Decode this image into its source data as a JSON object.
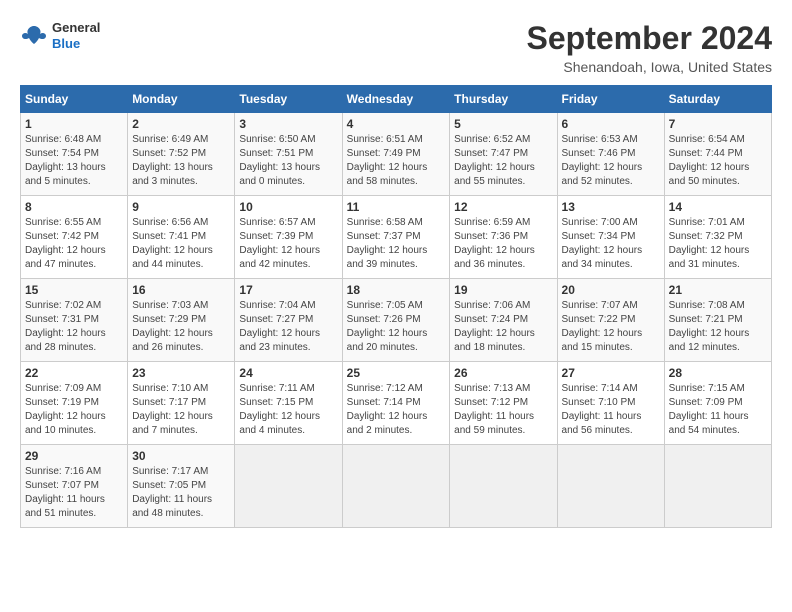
{
  "header": {
    "logo": {
      "general": "General",
      "blue": "Blue"
    },
    "title": "September 2024",
    "location": "Shenandoah, Iowa, United States"
  },
  "calendar": {
    "weekdays": [
      "Sunday",
      "Monday",
      "Tuesday",
      "Wednesday",
      "Thursday",
      "Friday",
      "Saturday"
    ],
    "weeks": [
      [
        {
          "day": "1",
          "sunrise": "6:48 AM",
          "sunset": "7:54 PM",
          "daylight": "13 hours and 5 minutes."
        },
        {
          "day": "2",
          "sunrise": "6:49 AM",
          "sunset": "7:52 PM",
          "daylight": "13 hours and 3 minutes."
        },
        {
          "day": "3",
          "sunrise": "6:50 AM",
          "sunset": "7:51 PM",
          "daylight": "13 hours and 0 minutes."
        },
        {
          "day": "4",
          "sunrise": "6:51 AM",
          "sunset": "7:49 PM",
          "daylight": "12 hours and 58 minutes."
        },
        {
          "day": "5",
          "sunrise": "6:52 AM",
          "sunset": "7:47 PM",
          "daylight": "12 hours and 55 minutes."
        },
        {
          "day": "6",
          "sunrise": "6:53 AM",
          "sunset": "7:46 PM",
          "daylight": "12 hours and 52 minutes."
        },
        {
          "day": "7",
          "sunrise": "6:54 AM",
          "sunset": "7:44 PM",
          "daylight": "12 hours and 50 minutes."
        }
      ],
      [
        {
          "day": "8",
          "sunrise": "6:55 AM",
          "sunset": "7:42 PM",
          "daylight": "12 hours and 47 minutes."
        },
        {
          "day": "9",
          "sunrise": "6:56 AM",
          "sunset": "7:41 PM",
          "daylight": "12 hours and 44 minutes."
        },
        {
          "day": "10",
          "sunrise": "6:57 AM",
          "sunset": "7:39 PM",
          "daylight": "12 hours and 42 minutes."
        },
        {
          "day": "11",
          "sunrise": "6:58 AM",
          "sunset": "7:37 PM",
          "daylight": "12 hours and 39 minutes."
        },
        {
          "day": "12",
          "sunrise": "6:59 AM",
          "sunset": "7:36 PM",
          "daylight": "12 hours and 36 minutes."
        },
        {
          "day": "13",
          "sunrise": "7:00 AM",
          "sunset": "7:34 PM",
          "daylight": "12 hours and 34 minutes."
        },
        {
          "day": "14",
          "sunrise": "7:01 AM",
          "sunset": "7:32 PM",
          "daylight": "12 hours and 31 minutes."
        }
      ],
      [
        {
          "day": "15",
          "sunrise": "7:02 AM",
          "sunset": "7:31 PM",
          "daylight": "12 hours and 28 minutes."
        },
        {
          "day": "16",
          "sunrise": "7:03 AM",
          "sunset": "7:29 PM",
          "daylight": "12 hours and 26 minutes."
        },
        {
          "day": "17",
          "sunrise": "7:04 AM",
          "sunset": "7:27 PM",
          "daylight": "12 hours and 23 minutes."
        },
        {
          "day": "18",
          "sunrise": "7:05 AM",
          "sunset": "7:26 PM",
          "daylight": "12 hours and 20 minutes."
        },
        {
          "day": "19",
          "sunrise": "7:06 AM",
          "sunset": "7:24 PM",
          "daylight": "12 hours and 18 minutes."
        },
        {
          "day": "20",
          "sunrise": "7:07 AM",
          "sunset": "7:22 PM",
          "daylight": "12 hours and 15 minutes."
        },
        {
          "day": "21",
          "sunrise": "7:08 AM",
          "sunset": "7:21 PM",
          "daylight": "12 hours and 12 minutes."
        }
      ],
      [
        {
          "day": "22",
          "sunrise": "7:09 AM",
          "sunset": "7:19 PM",
          "daylight": "12 hours and 10 minutes."
        },
        {
          "day": "23",
          "sunrise": "7:10 AM",
          "sunset": "7:17 PM",
          "daylight": "12 hours and 7 minutes."
        },
        {
          "day": "24",
          "sunrise": "7:11 AM",
          "sunset": "7:15 PM",
          "daylight": "12 hours and 4 minutes."
        },
        {
          "day": "25",
          "sunrise": "7:12 AM",
          "sunset": "7:14 PM",
          "daylight": "12 hours and 2 minutes."
        },
        {
          "day": "26",
          "sunrise": "7:13 AM",
          "sunset": "7:12 PM",
          "daylight": "11 hours and 59 minutes."
        },
        {
          "day": "27",
          "sunrise": "7:14 AM",
          "sunset": "7:10 PM",
          "daylight": "11 hours and 56 minutes."
        },
        {
          "day": "28",
          "sunrise": "7:15 AM",
          "sunset": "7:09 PM",
          "daylight": "11 hours and 54 minutes."
        }
      ],
      [
        {
          "day": "29",
          "sunrise": "7:16 AM",
          "sunset": "7:07 PM",
          "daylight": "11 hours and 51 minutes."
        },
        {
          "day": "30",
          "sunrise": "7:17 AM",
          "sunset": "7:05 PM",
          "daylight": "11 hours and 48 minutes."
        },
        null,
        null,
        null,
        null,
        null
      ]
    ]
  }
}
